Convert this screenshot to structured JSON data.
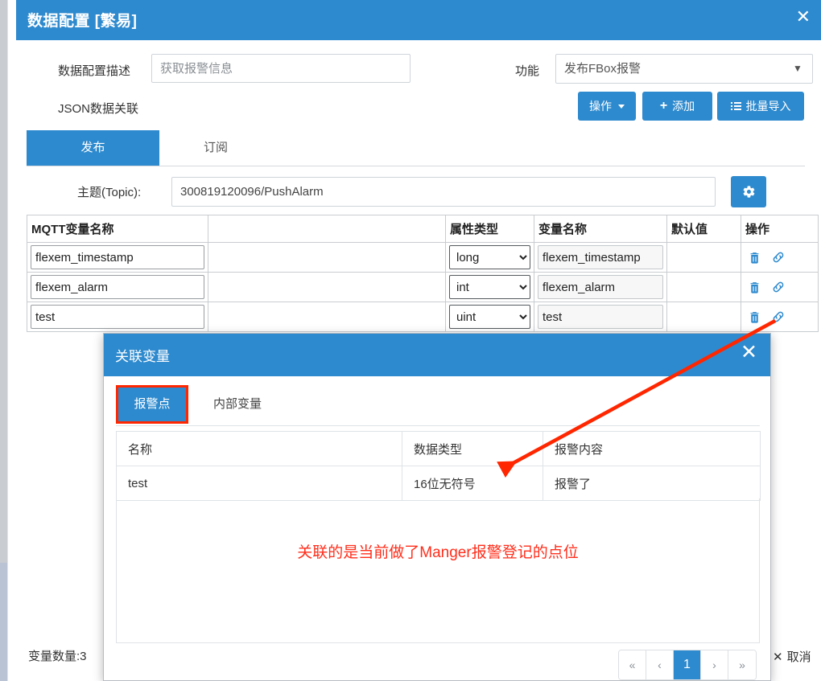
{
  "window": {
    "title": "数据配置 [繁易]",
    "close_label": "✕"
  },
  "form": {
    "desc_label": "数据配置描述",
    "desc_placeholder": "获取报警信息",
    "desc_value": "",
    "json_label": "JSON数据关联",
    "func_label": "功能",
    "func_value": "发布FBox报警",
    "func_options": [
      "发布FBox报警"
    ]
  },
  "toolbar": {
    "op_label": "操作",
    "add_label": "添加",
    "import_label": "批量导入"
  },
  "tabs": {
    "publish": "发布",
    "subscribe": "订阅"
  },
  "topic": {
    "label": "主题(Topic):",
    "value": "300819120096/PushAlarm",
    "gear_icon": "gear-icon"
  },
  "table": {
    "headers": [
      "MQTT变量名称",
      "",
      "属性类型",
      "变量名称",
      "默认值",
      "操作"
    ],
    "rows": [
      {
        "mqtt_name": "flexem_timestamp",
        "blank": "",
        "attr_type": "long",
        "var_name": "flexem_timestamp",
        "default_value": "",
        "op_delete_icon": "trash-icon",
        "op_link_icon": "link-icon"
      },
      {
        "mqtt_name": "flexem_alarm",
        "blank": "",
        "attr_type": "int",
        "var_name": "flexem_alarm",
        "default_value": "",
        "op_delete_icon": "trash-icon",
        "op_link_icon": "link-icon"
      },
      {
        "mqtt_name": "test",
        "blank": "",
        "attr_type": "uint",
        "var_name": "test",
        "default_value": "",
        "op_delete_icon": "trash-icon",
        "op_link_icon": "link-icon"
      }
    ],
    "attr_type_options": [
      "long",
      "int",
      "uint"
    ]
  },
  "footer": {
    "var_count": "变量数量:3",
    "cancel_label": "取消"
  },
  "modal": {
    "title": "关联变量",
    "close_label": "✕",
    "tabs": [
      {
        "label": "报警点",
        "active": true
      },
      {
        "label": "内部变量",
        "active": false
      }
    ],
    "table": {
      "headers": [
        "名称",
        "数据类型",
        "报警内容"
      ],
      "rows": [
        {
          "name": "test",
          "data_type": "16位无符号",
          "alarm_content": "报警了"
        }
      ]
    },
    "note": "关联的是当前做了Manger报警登记的点位",
    "pager": {
      "first": "«",
      "prev": "‹",
      "current": "1",
      "next": "›",
      "last": "»"
    }
  },
  "colors": {
    "brand_blue": "#2e8ace",
    "annotation_red": "#ff2600",
    "sidebar_blue": "#2b6cac"
  }
}
